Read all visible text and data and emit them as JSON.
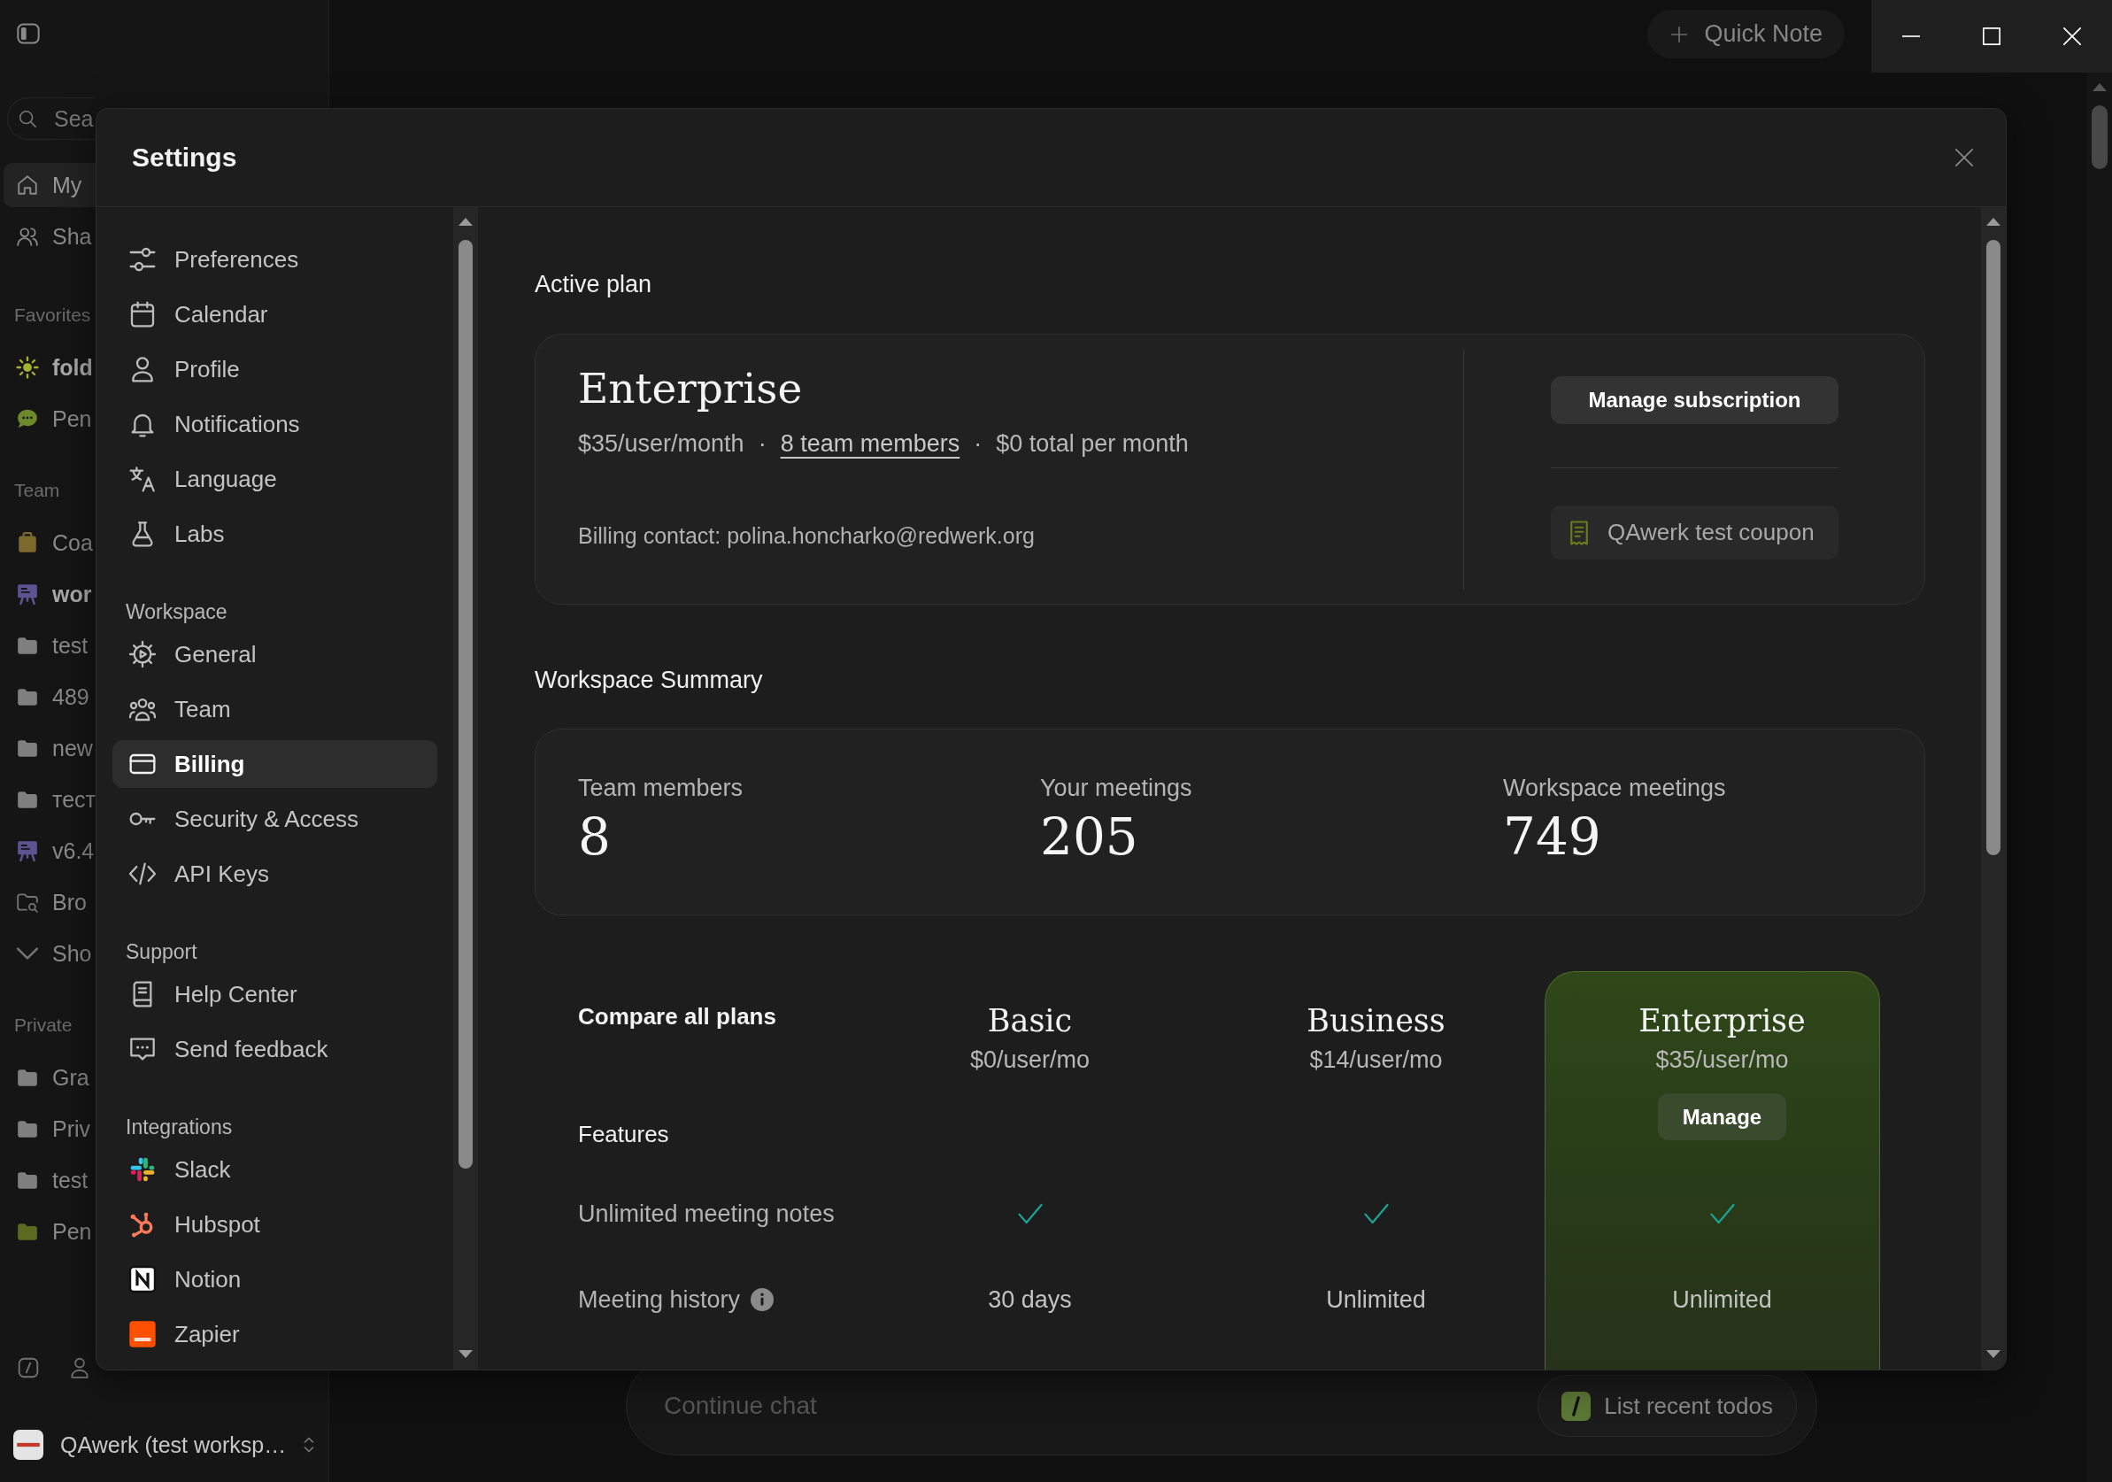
{
  "app_sidebar": {
    "search": {
      "placeholder": "Sea"
    },
    "items": [
      {
        "label": "My",
        "selected": true
      },
      {
        "label": "Sha",
        "selected": false
      }
    ],
    "sections": [
      {
        "title": "Favorites",
        "items": [
          {
            "label": "fold",
            "unread": true,
            "color": "#a4b22c"
          },
          {
            "label": "Pen",
            "unread": false,
            "color": "#6d8a2b"
          }
        ]
      },
      {
        "title": "Team",
        "items": [
          {
            "label": "Coa",
            "unread": false,
            "color": "#7c6a2d"
          },
          {
            "label": "wor",
            "unread": true,
            "color": "#5e5391"
          },
          {
            "label": "test",
            "unread": false,
            "color": "#7f7f7f"
          },
          {
            "label": "489",
            "unread": false,
            "color": "#7f7f7f"
          },
          {
            "label": "new",
            "unread": false,
            "color": "#7f7f7f"
          },
          {
            "label": "тест",
            "unread": false,
            "color": "#7f7f7f"
          },
          {
            "label": "v6.4",
            "unread": false,
            "color": "#5e5391"
          },
          {
            "label": "Bro",
            "unread": false,
            "color": "#737373"
          },
          {
            "label": "Sho",
            "unread": false,
            "color": "#737373"
          }
        ]
      },
      {
        "title": "Private",
        "items": [
          {
            "label": "Gra",
            "unread": false,
            "color": "#7f7f7f"
          },
          {
            "label": "Priv",
            "unread": false,
            "color": "#7f7f7f"
          },
          {
            "label": "test",
            "unread": false,
            "color": "#7f7f7f"
          },
          {
            "label": "Pen",
            "unread": false,
            "color": "#5c6a1f"
          }
        ]
      }
    ],
    "workspace": {
      "name": "QAwerk (test worksp…"
    }
  },
  "top_bar": {
    "quick_note": "Quick Note"
  },
  "settings": {
    "title": "Settings",
    "nav": {
      "items": [
        {
          "label": "Preferences",
          "selected": false
        },
        {
          "label": "Calendar",
          "selected": false
        },
        {
          "label": "Profile",
          "selected": false
        },
        {
          "label": "Notifications",
          "selected": false
        },
        {
          "label": "Language",
          "selected": false
        },
        {
          "label": "Labs",
          "selected": false
        }
      ],
      "sections": [
        {
          "title": "Workspace",
          "items": [
            {
              "label": "General",
              "selected": false
            },
            {
              "label": "Team",
              "selected": false
            },
            {
              "label": "Billing",
              "selected": true
            },
            {
              "label": "Security & Access",
              "selected": false
            },
            {
              "label": "API Keys",
              "selected": false
            }
          ]
        },
        {
          "title": "Support",
          "items": [
            {
              "label": "Help Center",
              "selected": false
            },
            {
              "label": "Send feedback",
              "selected": false
            }
          ]
        },
        {
          "title": "Integrations",
          "items": [
            {
              "label": "Slack",
              "selected": false
            },
            {
              "label": "Hubspot",
              "selected": false
            },
            {
              "label": "Notion",
              "selected": false
            },
            {
              "label": "Zapier",
              "selected": false
            }
          ]
        }
      ]
    },
    "active_plan": {
      "heading": "Active plan",
      "name": "Enterprise",
      "details": [
        {
          "kind": "text",
          "text": "$35/user/month"
        },
        {
          "kind": "separator",
          "text": "·"
        },
        {
          "kind": "link",
          "text": "8 team members"
        },
        {
          "kind": "separator",
          "text": "·"
        },
        {
          "kind": "text",
          "text": "$0 total per month"
        }
      ],
      "billing_contact": "Billing contact: polina.honcharko@redwerk.org",
      "manage_button": "Manage subscription",
      "coupon": "QAwerk test coupon"
    },
    "workspace_summary": {
      "heading": "Workspace Summary",
      "stats": [
        {
          "label": "Team members",
          "value": "8"
        },
        {
          "label": "Your meetings",
          "value": "205"
        },
        {
          "label": "Workspace meetings",
          "value": "749"
        }
      ]
    },
    "compare_plans": {
      "title": "Compare all plans",
      "features_heading": "Features",
      "plans": [
        {
          "name": "Basic",
          "price": "$0/user/mo",
          "current": false
        },
        {
          "name": "Business",
          "price": "$14/user/mo",
          "current": false
        },
        {
          "name": "Enterprise",
          "price": "$35/user/mo",
          "current": true,
          "action": "Manage"
        }
      ],
      "features": [
        {
          "name": "Unlimited meeting notes",
          "info": false,
          "values": [
            {
              "kind": "check"
            },
            {
              "kind": "check"
            },
            {
              "kind": "check"
            }
          ]
        },
        {
          "name": "Meeting history",
          "info": true,
          "values": [
            {
              "kind": "text",
              "text": "30 days"
            },
            {
              "kind": "text",
              "text": "Unlimited"
            },
            {
              "kind": "text",
              "text": "Unlimited"
            }
          ]
        }
      ]
    }
  },
  "chat": {
    "placeholder": "Continue chat",
    "suggestion": "List recent todos"
  }
}
